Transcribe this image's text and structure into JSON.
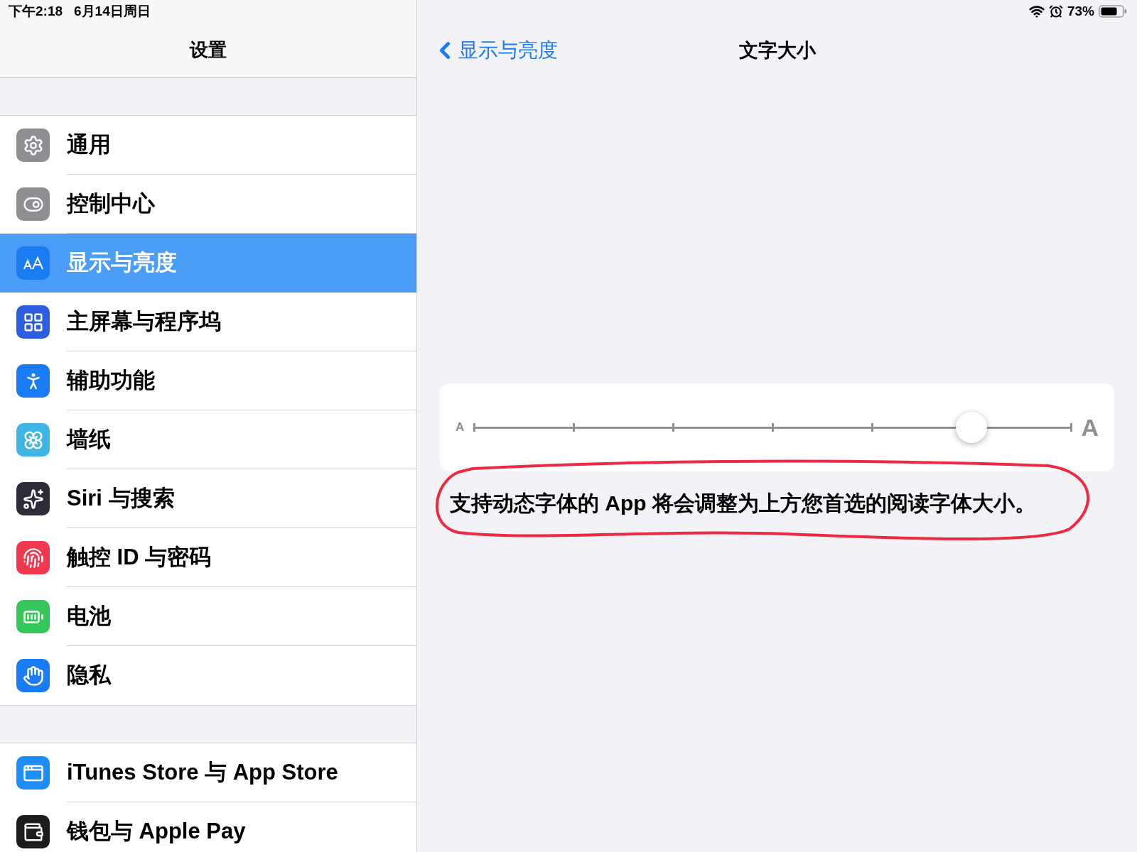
{
  "status_bar": {
    "time": "下午2:18",
    "date": "6月14日周日",
    "battery": "73%"
  },
  "sidebar": {
    "title": "设置",
    "groups": [
      [
        {
          "label": "通用",
          "color": "#8e8e93",
          "selected": false
        },
        {
          "label": "控制中心",
          "color": "#8e8e93",
          "selected": false
        },
        {
          "label": "显示与亮度",
          "color": "#1a7cf5",
          "selected": true
        },
        {
          "label": "主屏幕与程序坞",
          "color": "#2c5ee0",
          "selected": false
        },
        {
          "label": "辅助功能",
          "color": "#1a7cf5",
          "selected": false
        },
        {
          "label": "墙纸",
          "color": "#3fb5e6",
          "selected": false
        },
        {
          "label": "Siri 与搜索",
          "color": "#2b2b3a",
          "selected": false
        },
        {
          "label": "触控 ID 与密码",
          "color": "#f2384f",
          "selected": false
        },
        {
          "label": "电池",
          "color": "#34c759",
          "selected": false
        },
        {
          "label": "隐私",
          "color": "#1a7cf5",
          "selected": false
        }
      ],
      [
        {
          "label": "iTunes Store 与 App Store",
          "color": "#1c8ef6",
          "selected": false
        },
        {
          "label": "钱包与 Apple Pay",
          "color": "#1c1c1e",
          "selected": false
        }
      ]
    ]
  },
  "detail": {
    "back": "显示与亮度",
    "title": "文字大小",
    "slider": {
      "small_label": "A",
      "large_label": "A",
      "level": 0.833
    },
    "description": "支持动态字体的 App 将会调整为上方您首选的阅读字体大小。"
  }
}
